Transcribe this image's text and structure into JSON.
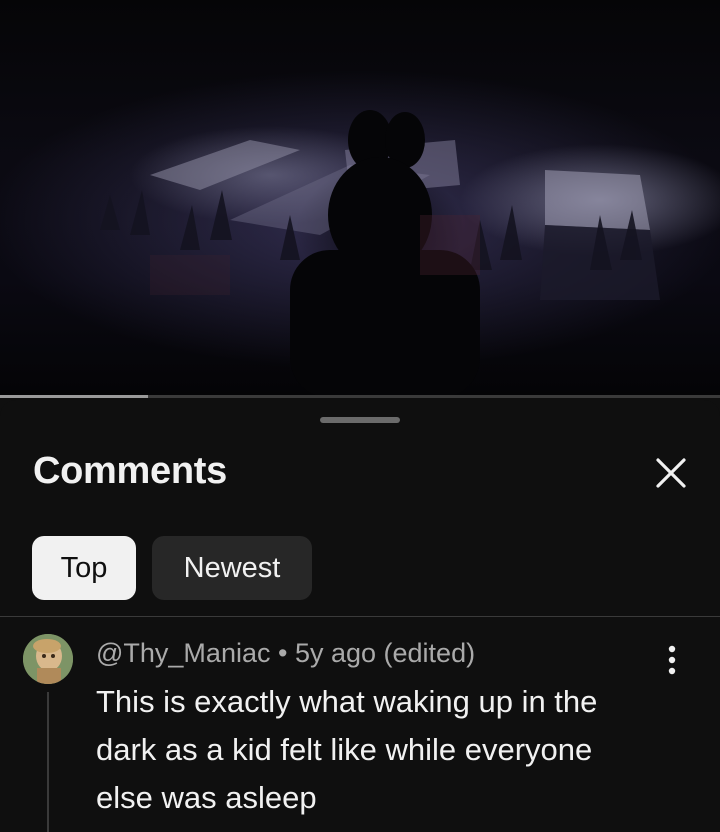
{
  "video": {
    "progress_fraction": 0.205
  },
  "comments_panel": {
    "title": "Comments",
    "close_icon": "close-icon",
    "tabs": [
      {
        "label": "Top",
        "selected": true
      },
      {
        "label": "Newest",
        "selected": false
      }
    ],
    "comments": [
      {
        "author": "@Thy_Maniac",
        "separator": "•",
        "time": "5y ago (edited)",
        "text": "This is exactly what waking up in the dark as a kid felt like while everyone else was asleep",
        "menu_icon": "more-vert-icon",
        "avatar_icon": "user-avatar"
      }
    ]
  },
  "colors": {
    "background": "#0f0f0f",
    "text_primary": "#f1f1f1",
    "text_secondary": "#aaaaaa",
    "chip_selected": "#f1f1f1",
    "chip_unselected": "#272727"
  }
}
